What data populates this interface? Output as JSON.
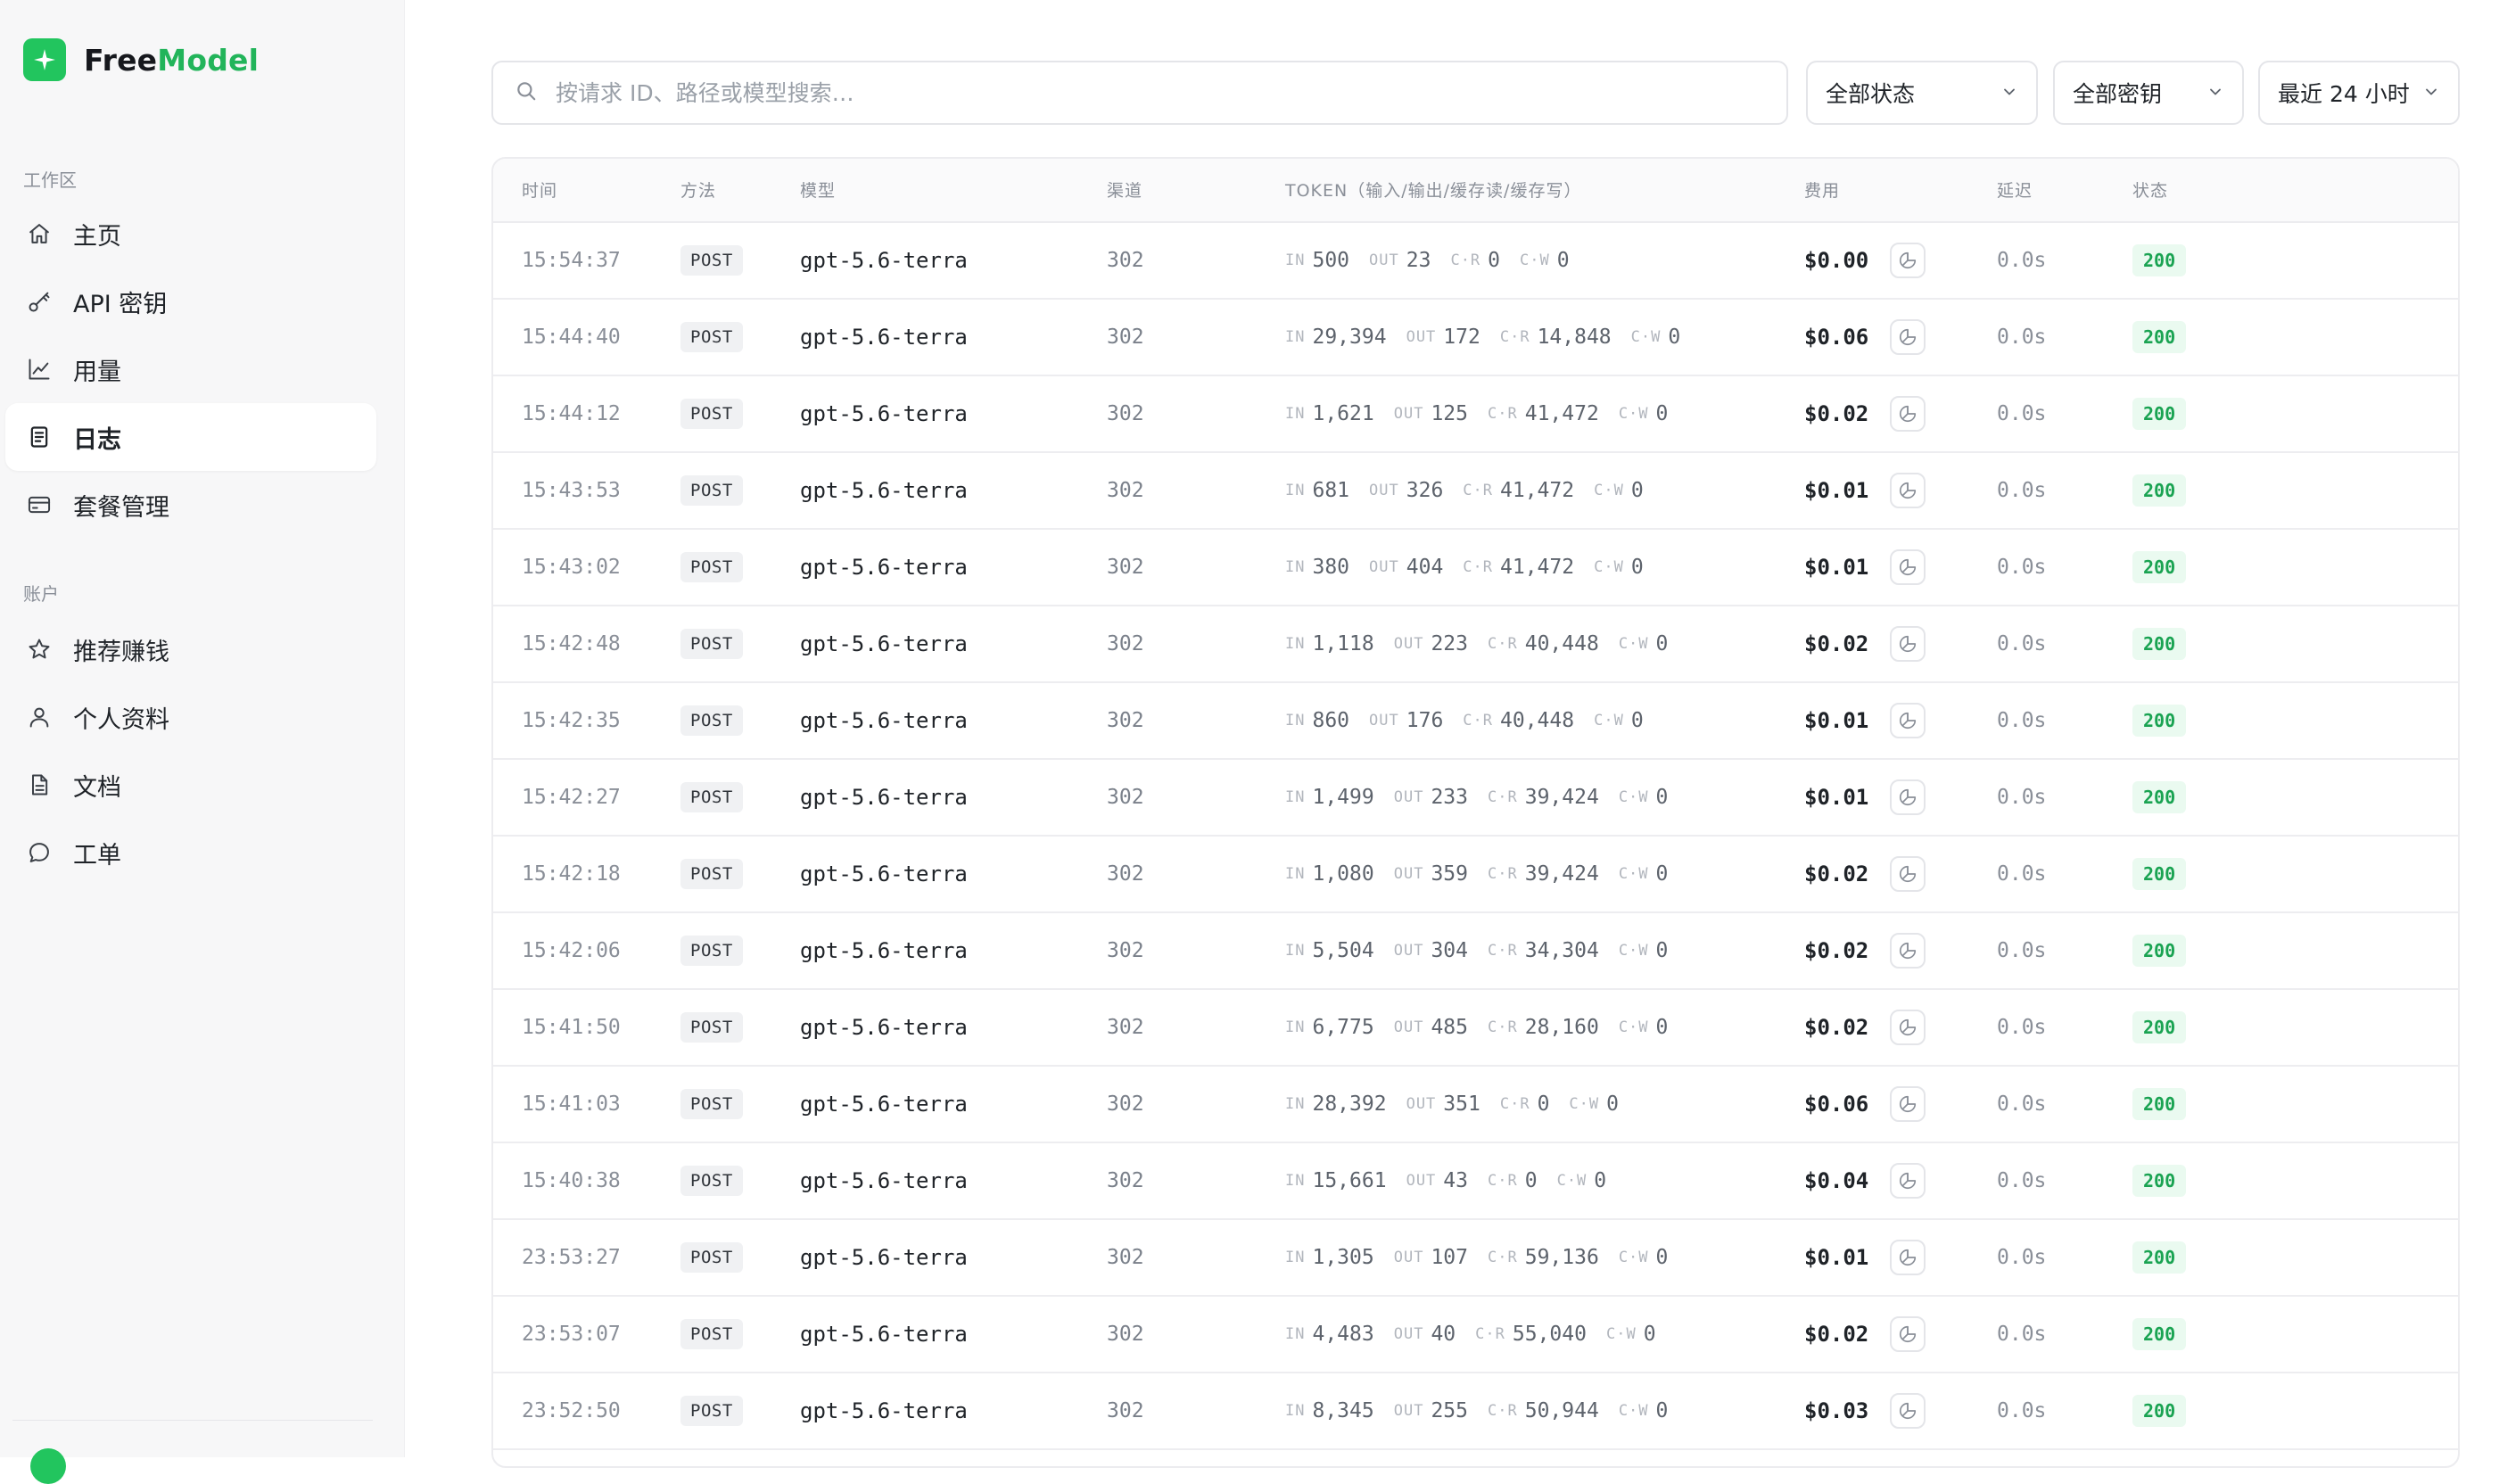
{
  "brand": {
    "name_part1": "Free",
    "name_part2": "Model"
  },
  "sidebar": {
    "section_workspace": "工作区",
    "section_account": "账户",
    "workspace_items": [
      {
        "label": "主页",
        "icon": "home-icon"
      },
      {
        "label": "API 密钥",
        "icon": "key-icon"
      },
      {
        "label": "用量",
        "icon": "chart-icon"
      },
      {
        "label": "日志",
        "icon": "log-icon",
        "active": true
      },
      {
        "label": "套餐管理",
        "icon": "card-icon"
      }
    ],
    "account_items": [
      {
        "label": "推荐赚钱",
        "icon": "star-icon"
      },
      {
        "label": "个人资料",
        "icon": "user-icon"
      },
      {
        "label": "文档",
        "icon": "doc-icon"
      },
      {
        "label": "工单",
        "icon": "chat-icon"
      }
    ]
  },
  "toolbar": {
    "search_placeholder": "按请求 ID、路径或模型搜索…",
    "status_select": "全部状态",
    "key_select": "全部密钥",
    "time_select": "最近 24 小时"
  },
  "table": {
    "headers": {
      "time": "时间",
      "method": "方法",
      "model": "模型",
      "channel": "渠道",
      "token": "TOKEN（输入/输出/缓存读/缓存写）",
      "cost": "费用",
      "latency": "延迟",
      "status": "状态"
    },
    "token_labels": {
      "in": "IN",
      "out": "OUT",
      "cr": "C·R",
      "cw": "C·W"
    },
    "rows": [
      {
        "time": "15:54:37",
        "method": "POST",
        "model": "gpt-5.6-terra",
        "channel": "302",
        "in": "500",
        "out": "23",
        "cr": "0",
        "cw": "0",
        "cost": "$0.00",
        "latency": "0.0s",
        "status": "200"
      },
      {
        "time": "15:44:40",
        "method": "POST",
        "model": "gpt-5.6-terra",
        "channel": "302",
        "in": "29,394",
        "out": "172",
        "cr": "14,848",
        "cw": "0",
        "cost": "$0.06",
        "latency": "0.0s",
        "status": "200"
      },
      {
        "time": "15:44:12",
        "method": "POST",
        "model": "gpt-5.6-terra",
        "channel": "302",
        "in": "1,621",
        "out": "125",
        "cr": "41,472",
        "cw": "0",
        "cost": "$0.02",
        "latency": "0.0s",
        "status": "200"
      },
      {
        "time": "15:43:53",
        "method": "POST",
        "model": "gpt-5.6-terra",
        "channel": "302",
        "in": "681",
        "out": "326",
        "cr": "41,472",
        "cw": "0",
        "cost": "$0.01",
        "latency": "0.0s",
        "status": "200"
      },
      {
        "time": "15:43:02",
        "method": "POST",
        "model": "gpt-5.6-terra",
        "channel": "302",
        "in": "380",
        "out": "404",
        "cr": "41,472",
        "cw": "0",
        "cost": "$0.01",
        "latency": "0.0s",
        "status": "200"
      },
      {
        "time": "15:42:48",
        "method": "POST",
        "model": "gpt-5.6-terra",
        "channel": "302",
        "in": "1,118",
        "out": "223",
        "cr": "40,448",
        "cw": "0",
        "cost": "$0.02",
        "latency": "0.0s",
        "status": "200"
      },
      {
        "time": "15:42:35",
        "method": "POST",
        "model": "gpt-5.6-terra",
        "channel": "302",
        "in": "860",
        "out": "176",
        "cr": "40,448",
        "cw": "0",
        "cost": "$0.01",
        "latency": "0.0s",
        "status": "200"
      },
      {
        "time": "15:42:27",
        "method": "POST",
        "model": "gpt-5.6-terra",
        "channel": "302",
        "in": "1,499",
        "out": "233",
        "cr": "39,424",
        "cw": "0",
        "cost": "$0.01",
        "latency": "0.0s",
        "status": "200"
      },
      {
        "time": "15:42:18",
        "method": "POST",
        "model": "gpt-5.6-terra",
        "channel": "302",
        "in": "1,080",
        "out": "359",
        "cr": "39,424",
        "cw": "0",
        "cost": "$0.02",
        "latency": "0.0s",
        "status": "200"
      },
      {
        "time": "15:42:06",
        "method": "POST",
        "model": "gpt-5.6-terra",
        "channel": "302",
        "in": "5,504",
        "out": "304",
        "cr": "34,304",
        "cw": "0",
        "cost": "$0.02",
        "latency": "0.0s",
        "status": "200"
      },
      {
        "time": "15:41:50",
        "method": "POST",
        "model": "gpt-5.6-terra",
        "channel": "302",
        "in": "6,775",
        "out": "485",
        "cr": "28,160",
        "cw": "0",
        "cost": "$0.02",
        "latency": "0.0s",
        "status": "200"
      },
      {
        "time": "15:41:03",
        "method": "POST",
        "model": "gpt-5.6-terra",
        "channel": "302",
        "in": "28,392",
        "out": "351",
        "cr": "0",
        "cw": "0",
        "cost": "$0.06",
        "latency": "0.0s",
        "status": "200"
      },
      {
        "time": "15:40:38",
        "method": "POST",
        "model": "gpt-5.6-terra",
        "channel": "302",
        "in": "15,661",
        "out": "43",
        "cr": "0",
        "cw": "0",
        "cost": "$0.04",
        "latency": "0.0s",
        "status": "200"
      },
      {
        "time": "23:53:27",
        "method": "POST",
        "model": "gpt-5.6-terra",
        "channel": "302",
        "in": "1,305",
        "out": "107",
        "cr": "59,136",
        "cw": "0",
        "cost": "$0.01",
        "latency": "0.0s",
        "status": "200"
      },
      {
        "time": "23:53:07",
        "method": "POST",
        "model": "gpt-5.6-terra",
        "channel": "302",
        "in": "4,483",
        "out": "40",
        "cr": "55,040",
        "cw": "0",
        "cost": "$0.02",
        "latency": "0.0s",
        "status": "200"
      },
      {
        "time": "23:52:50",
        "method": "POST",
        "model": "gpt-5.6-terra",
        "channel": "302",
        "in": "8,345",
        "out": "255",
        "cr": "50,944",
        "cw": "0",
        "cost": "$0.03",
        "latency": "0.0s",
        "status": "200"
      }
    ]
  }
}
